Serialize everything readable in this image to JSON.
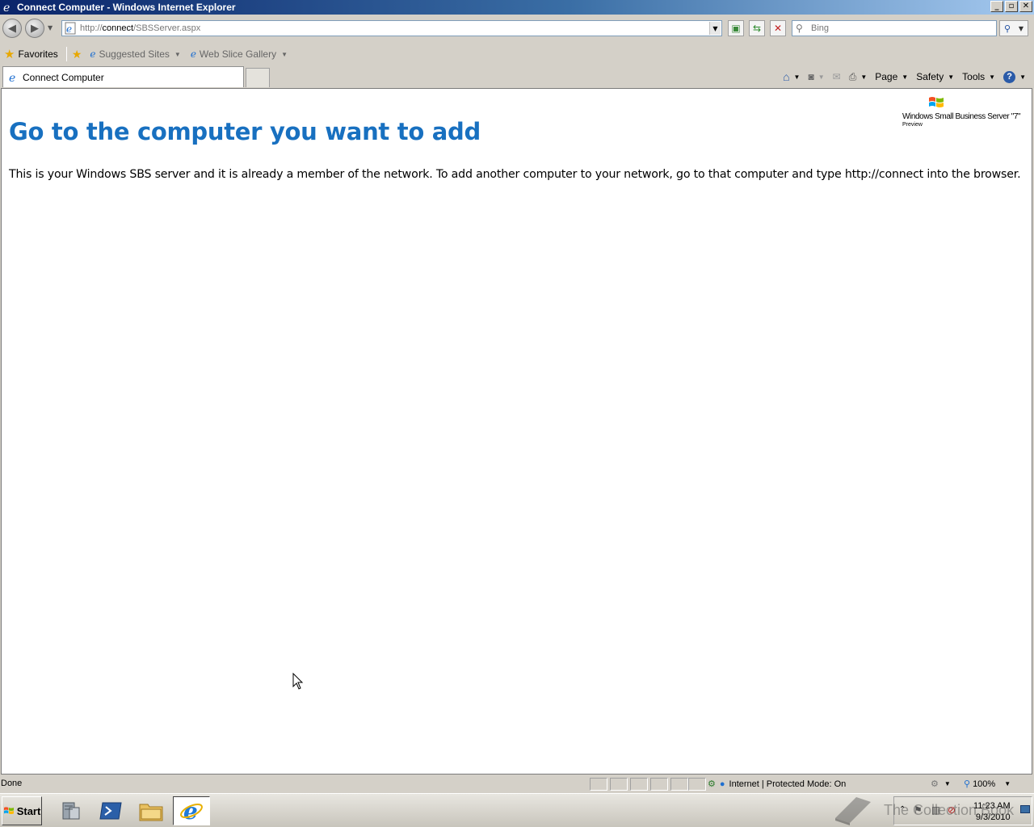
{
  "window": {
    "title": "Connect Computer - Windows Internet Explorer",
    "buttons": [
      "minimize",
      "restore",
      "close"
    ]
  },
  "address_bar": {
    "url_prefix": "http://",
    "url_host": "connect",
    "url_path": "/SBSServer.aspx",
    "search_placeholder": "Bing"
  },
  "favorites_bar": {
    "favorites_label": "Favorites",
    "items": [
      {
        "label": "Suggested Sites"
      },
      {
        "label": "Web Slice Gallery"
      }
    ]
  },
  "tabs": [
    {
      "label": "Connect Computer",
      "active": true
    }
  ],
  "command_bar": {
    "page_label": "Page",
    "safety_label": "Safety",
    "tools_label": "Tools"
  },
  "page": {
    "logo_text": "Windows Small Business Server \"7\"",
    "logo_subtext": "Preview",
    "heading": "Go to the computer you want to add",
    "body": "This is your Windows SBS server and it is already a member of the network. To add another computer to your network, go to that computer and type http://connect into the browser."
  },
  "status_bar": {
    "status": "Done",
    "zone": "Internet | Protected Mode: On",
    "zoom": "100%"
  },
  "taskbar": {
    "start_label": "Start",
    "time": "11:23 AM",
    "date": "9/3/2010",
    "watermark": "The Collection Book"
  },
  "colors": {
    "heading": "#1870c0",
    "titlebar_start": "#0a246a",
    "titlebar_end": "#a6caf0"
  }
}
